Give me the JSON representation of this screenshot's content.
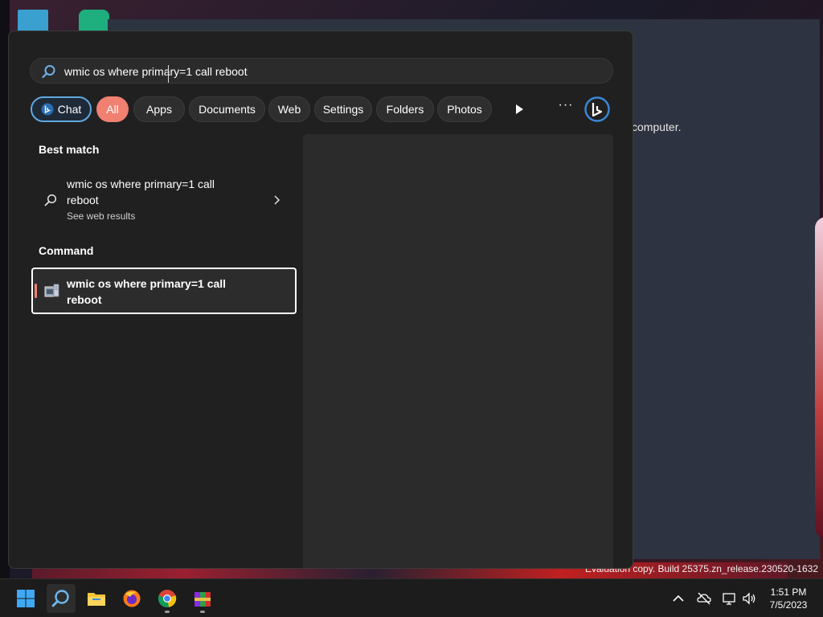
{
  "background": {
    "window_text": "computer.",
    "watermark": "Evaluation copy. Build 25375.zn_release.230520-1632"
  },
  "search": {
    "query": "wmic os where primary=1 call reboot",
    "icon": "search-icon"
  },
  "filters": {
    "chat_label": "Chat",
    "items": [
      {
        "label": "All",
        "active": true
      },
      {
        "label": "Apps"
      },
      {
        "label": "Documents"
      },
      {
        "label": "Web"
      },
      {
        "label": "Settings"
      },
      {
        "label": "Folders"
      },
      {
        "label": "Photos"
      }
    ],
    "more_icon": "ellipsis-icon",
    "play_icon": "play-icon",
    "bing_icon": "bing-icon"
  },
  "best_match": {
    "heading": "Best match",
    "title": "wmic os where primary=1 call reboot",
    "subtitle": "See web results"
  },
  "command": {
    "heading": "Command",
    "title": "wmic os where primary=1 call reboot"
  },
  "taskbar": {
    "apps": [
      "start-icon",
      "search-icon",
      "file-explorer-icon",
      "firefox-icon",
      "chrome-icon",
      "winrar-icon"
    ],
    "time": "1:51 PM",
    "date": "7/5/2023"
  },
  "colors": {
    "accent": "#f08070",
    "chat_border": "#60a8e0",
    "panel_bg": "#202020"
  }
}
